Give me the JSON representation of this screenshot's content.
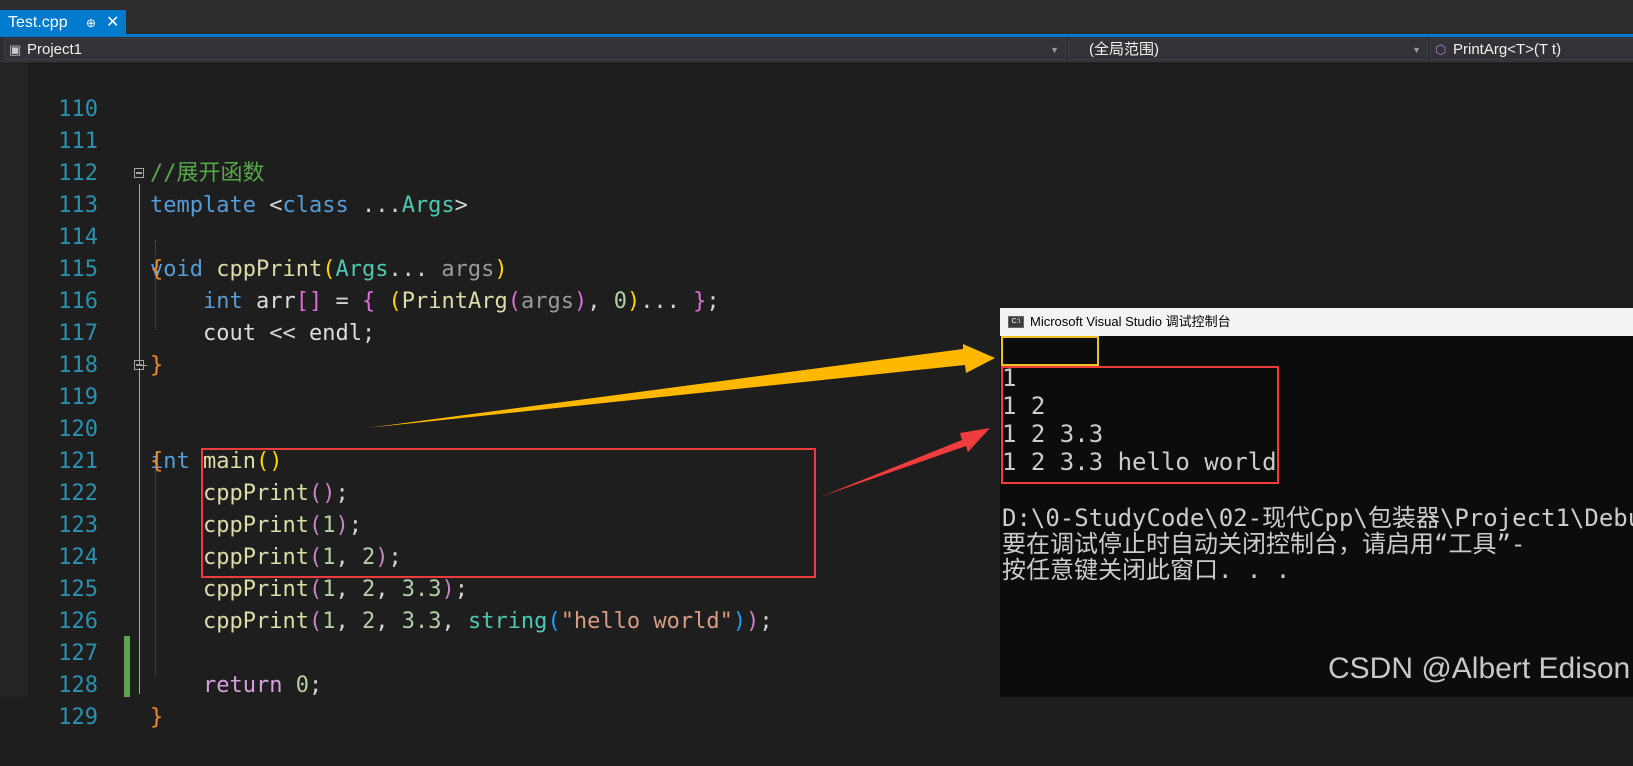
{
  "tab": {
    "title": "Test.cpp",
    "pin_glyph": "⊕",
    "close_glyph": "✕"
  },
  "navbar": {
    "project": "Project1",
    "scope": "(全局范围)",
    "member": "PrintArg<T>(T t)"
  },
  "code_lines": [
    {
      "num": "110"
    },
    {
      "num": "111",
      "comment": "//展开函数"
    },
    {
      "num": "112",
      "template": "template",
      "class_kw": "class",
      "args_type": "Args"
    },
    {
      "num": "113",
      "void": "void",
      "fn": "cppPrint",
      "args_type": "Args",
      "param": "args"
    },
    {
      "num": "114",
      "brace": "{"
    },
    {
      "num": "115",
      "int": "int",
      "var": "arr",
      "fn": "PrintArg",
      "param": "args",
      "zero": "0"
    },
    {
      "num": "116",
      "cout": "cout",
      "endl": "endl"
    },
    {
      "num": "117",
      "brace": "}"
    },
    {
      "num": "118"
    },
    {
      "num": "119",
      "int": "int",
      "fn": "main"
    },
    {
      "num": "120",
      "brace": "{"
    },
    {
      "num": "121",
      "fn": "cppPrint"
    },
    {
      "num": "122",
      "fn": "cppPrint",
      "a1": "1"
    },
    {
      "num": "123",
      "fn": "cppPrint",
      "a1": "1",
      "a2": "2"
    },
    {
      "num": "124",
      "fn": "cppPrint",
      "a1": "1",
      "a2": "2",
      "a3": "3.3"
    },
    {
      "num": "125",
      "fn": "cppPrint",
      "a1": "1",
      "a2": "2",
      "a3": "3.3",
      "string_type": "string",
      "str": "\"hello world\""
    },
    {
      "num": "126"
    },
    {
      "num": "127",
      "return": "return",
      "zero": "0"
    },
    {
      "num": "128",
      "brace": "}"
    },
    {
      "num": "129"
    }
  ],
  "console": {
    "title": "Microsoft Visual Studio 调试控制台",
    "icon_text": "C:\\",
    "output": [
      "",
      "1",
      "1 2",
      "1 2 3.3",
      "1 2 3.3 hello world",
      "",
      "D:\\0-StudyCode\\02-现代Cpp\\包装器\\Project1\\Debu",
      "要在调试停止时自动关闭控制台，请启用“工具”-",
      "按任意键关闭此窗口. . ."
    ]
  },
  "watermark": "CSDN @Albert Edison",
  "colors": {
    "accent": "#007acc",
    "highlight_red": "#f03c3c",
    "highlight_yellow": "#f0c020",
    "arrow_yellow": "#ffb800",
    "arrow_red": "#f03c3c"
  }
}
